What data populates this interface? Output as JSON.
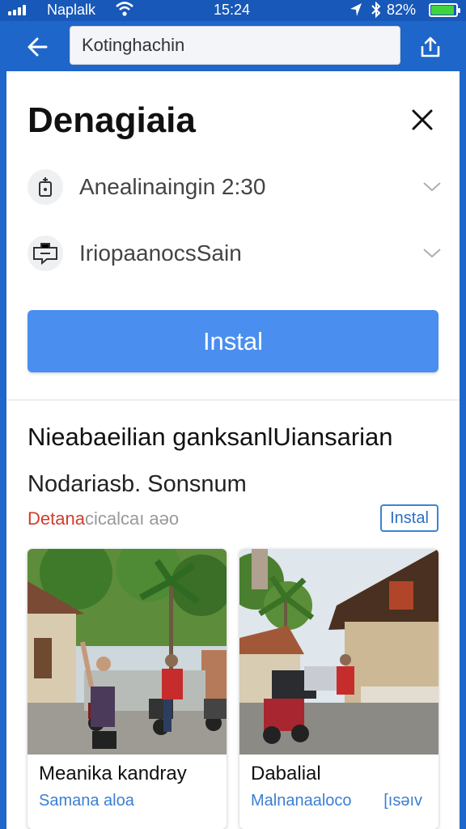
{
  "status_bar": {
    "carrier": "Naplalk",
    "time": "15:24",
    "battery_pct": "82%"
  },
  "app_bar": {
    "url": "Kotinghachin"
  },
  "sheet": {
    "title": "Denagiaia",
    "options": [
      {
        "label": "Anealinaingin 2:30",
        "icon": "ticket-icon"
      },
      {
        "label": "IriopaanocsSain",
        "icon": "screen-share-icon"
      }
    ],
    "install_label": "Instal"
  },
  "section": {
    "heading": "Nieabaeilian ganksanlUiansarian",
    "subheading": "Nodariasb. Sonsnum",
    "tag_red": "Detana",
    "tag_gray": "cicalcaı aəo",
    "install_label": "Instal"
  },
  "cards": [
    {
      "title": "Meanika kandray",
      "subtitle": "Samana aloa",
      "badge": ""
    },
    {
      "title": "Dabalial",
      "subtitle": "Malnanaaloco",
      "badge": "[ısəıv"
    }
  ],
  "colors": {
    "app_bar": "#1e66c9",
    "primary_button": "#4a8ff0",
    "link": "#3b7fd2",
    "tag_red": "#d23b2a",
    "battery": "#3fd33f"
  }
}
